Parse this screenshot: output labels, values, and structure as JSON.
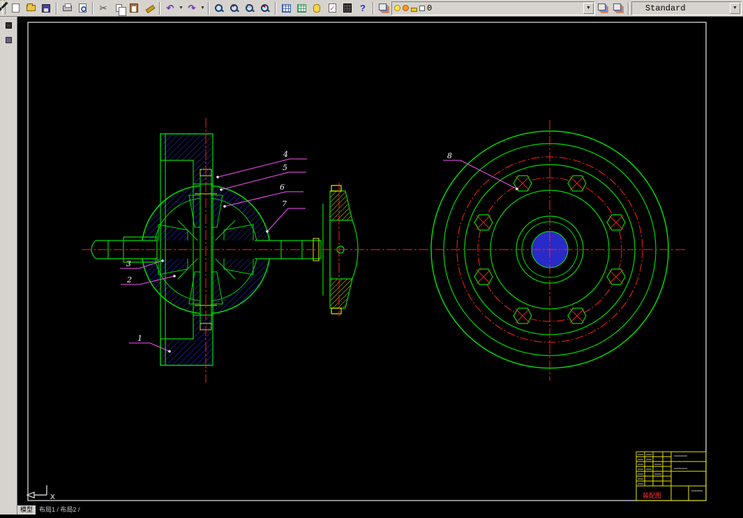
{
  "toolbar": {
    "icons": [
      "new",
      "open",
      "save",
      "plot",
      "plot-preview",
      "cut",
      "copy",
      "paste",
      "match-properties",
      "undo",
      "redo",
      "zoom-realtime",
      "zoom-in",
      "zoom-window",
      "zoom-previous",
      "table",
      "datagrid",
      "dbconnect",
      "markup",
      "calculator",
      "help",
      "layer-manager",
      "bulb",
      "sun",
      "lock",
      "color-swatch",
      "make-layer-current",
      "layer-previous",
      "pen"
    ],
    "layer_combo": {
      "value": "0"
    },
    "style_combo": {
      "value": "Standard"
    }
  },
  "canvas": {
    "part_labels": [
      "1",
      "2",
      "3",
      "4",
      "5",
      "6",
      "7",
      "8"
    ],
    "ucs_x_label": "X",
    "colors": {
      "outline": "#00d900",
      "centerline": "#ff2020",
      "hatch_blue": "#2a2ae0",
      "accent_yellow": "#e8e800",
      "leader_magenta": "#ff50ff",
      "sheet_border": "#e8e8e8",
      "hub_fill": "#2a2ac8"
    }
  },
  "title_block": {
    "label": "装配图"
  },
  "statusbar": {
    "active_tab": "模型",
    "tabs": "布局1 / 布局2 /"
  }
}
